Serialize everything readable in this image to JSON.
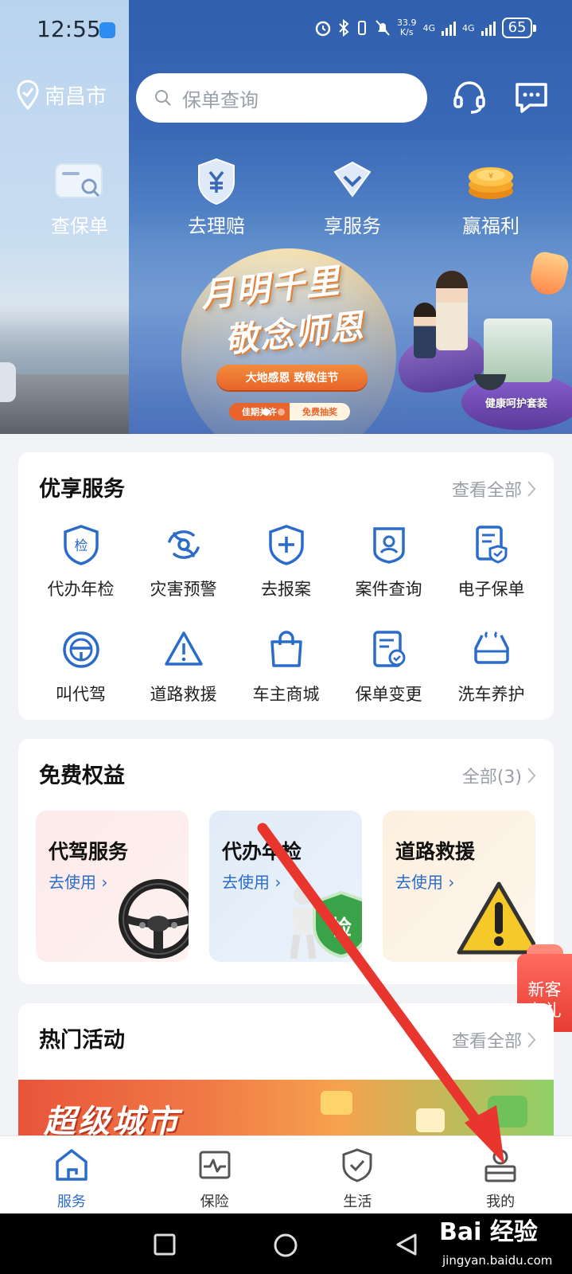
{
  "status_bar": {
    "time": "12:55",
    "speed_value": "33.9",
    "speed_unit": "K/s",
    "net1": "4G",
    "net2": "4G",
    "battery": "65"
  },
  "header": {
    "location": "南昌市",
    "search_placeholder": "保单查询",
    "support_icon": "headset-icon",
    "message_icon": "message-icon"
  },
  "quick_actions": [
    {
      "label": "查保单",
      "icon": "policy-search-icon"
    },
    {
      "label": "去理赔",
      "icon": "claim-yuan-icon"
    },
    {
      "label": "享服务",
      "icon": "service-shield-icon"
    },
    {
      "label": "赢福利",
      "icon": "coins-icon"
    }
  ],
  "banner": {
    "line1": "月明千里",
    "line2": "敬念师恩",
    "pill": "大地感恩 致敬佳节",
    "tag_left": "佳期共许",
    "tag_right": "免费抽奖",
    "gift_label": "健康呵护套装"
  },
  "services": {
    "title": "优享服务",
    "more": "查看全部",
    "items": [
      {
        "label": "代办年检",
        "icon": "inspection-badge-icon"
      },
      {
        "label": "灾害预警",
        "icon": "typhoon-icon"
      },
      {
        "label": "去报案",
        "icon": "report-shield-icon"
      },
      {
        "label": "案件查询",
        "icon": "case-search-icon"
      },
      {
        "label": "电子保单",
        "icon": "e-policy-icon"
      },
      {
        "label": "叫代驾",
        "icon": "steering-wheel-icon"
      },
      {
        "label": "道路救援",
        "icon": "warning-triangle-icon"
      },
      {
        "label": "车主商城",
        "icon": "shopping-bag-icon"
      },
      {
        "label": "保单变更",
        "icon": "policy-change-icon"
      },
      {
        "label": "洗车养护",
        "icon": "car-wash-icon"
      }
    ]
  },
  "benefits": {
    "title": "免费权益",
    "more": "全部(3)",
    "items": [
      {
        "title": "代驾服务",
        "action": "去使用"
      },
      {
        "title": "代办年检",
        "action": "去使用",
        "badge": "检"
      },
      {
        "title": "道路救援",
        "action": "去使用"
      }
    ]
  },
  "activities": {
    "title": "热门活动",
    "more": "查看全部",
    "banner_text": "超级城市"
  },
  "floating": {
    "line1": "新客",
    "line2": "有礼"
  },
  "tabs": [
    {
      "label": "服务",
      "icon": "home-service-icon",
      "active": true
    },
    {
      "label": "保险",
      "icon": "insurance-pulse-icon",
      "active": false
    },
    {
      "label": "生活",
      "icon": "life-shield-icon",
      "active": false
    },
    {
      "label": "我的",
      "icon": "profile-icon",
      "active": false
    }
  ],
  "watermark": {
    "brand": "Bai 经验",
    "url": "jingyan.baidu.com"
  },
  "colors": {
    "accent_blue": "#2c6cc9",
    "header_blue": "#2f5fae",
    "arrow_red": "#e8352e"
  }
}
